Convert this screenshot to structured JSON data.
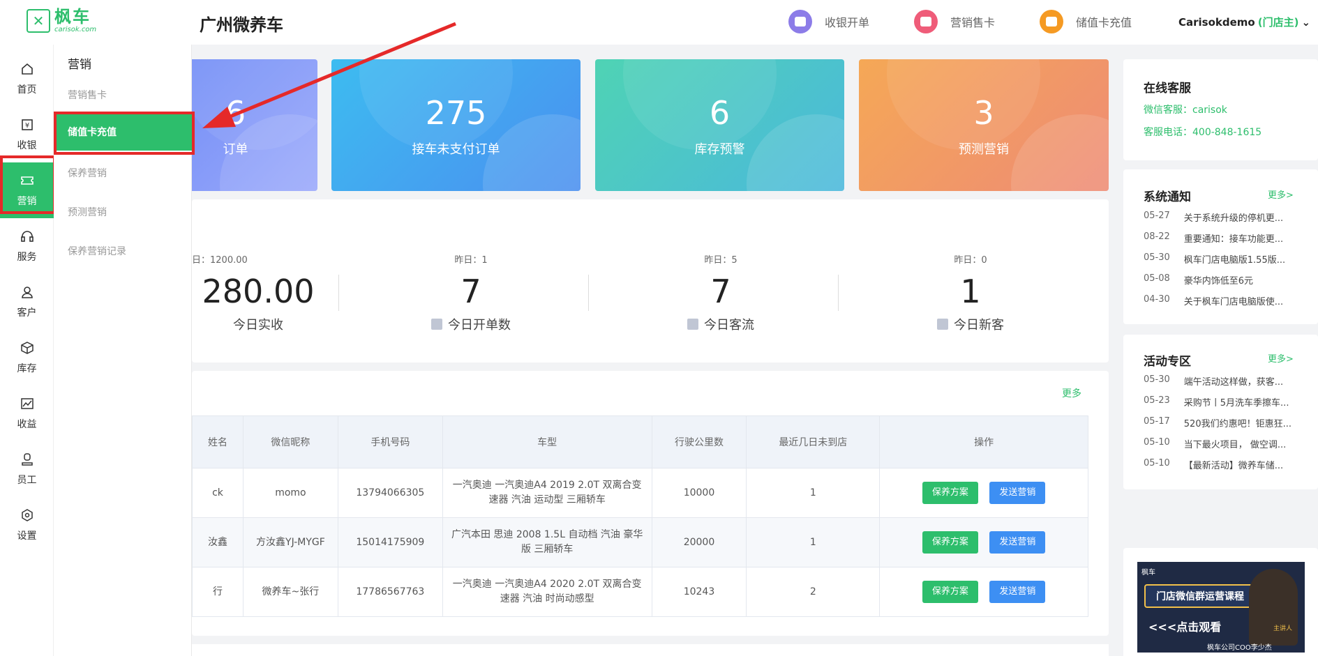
{
  "brand": {
    "name": "枫车",
    "sub": "carisok.com"
  },
  "header": {
    "store_name": "广州微养车",
    "actions": [
      {
        "label": "收银开单",
        "icon": "receipt-icon",
        "color": "#8c7ce8"
      },
      {
        "label": "营销售卡",
        "icon": "card-icon",
        "color": "#ef5c79"
      },
      {
        "label": "储值卡充值",
        "icon": "wallet-icon",
        "color": "#f59a23"
      }
    ],
    "user": "Carisokdemo",
    "role": "(门店主)"
  },
  "sidebar": {
    "items": [
      {
        "label": "首页",
        "icon": "home-icon"
      },
      {
        "label": "收银",
        "icon": "yen-icon"
      },
      {
        "label": "营销",
        "icon": "ticket-icon"
      },
      {
        "label": "服务",
        "icon": "headset-icon"
      },
      {
        "label": "客户",
        "icon": "person-icon"
      },
      {
        "label": "库存",
        "icon": "box-icon"
      },
      {
        "label": "收益",
        "icon": "chart-icon"
      },
      {
        "label": "员工",
        "icon": "staff-icon"
      },
      {
        "label": "设置",
        "icon": "settings-icon"
      }
    ],
    "active_index": 2
  },
  "submenu": {
    "title": "营销",
    "items": [
      "营销售卡",
      "储值卡充值",
      "保养营销",
      "预测营销",
      "保养营销记录"
    ],
    "active_index": 1
  },
  "stat_cards": [
    {
      "value": "6",
      "label": "订单",
      "color_from": "#6f8cf6",
      "color_to": "#9aa8fb"
    },
    {
      "value": "275",
      "label": "接车未支付订单",
      "color_from": "#3dbcf0",
      "color_to": "#4a8ff0"
    },
    {
      "value": "6",
      "label": "库存预警",
      "color_from": "#4fd3b4",
      "color_to": "#4bb8dc"
    },
    {
      "value": "3",
      "label": "预测营销",
      "color_from": "#f5a856",
      "color_to": "#ee8b75"
    }
  ],
  "metrics": [
    {
      "yesterday": "日：1200.00",
      "value": "280.00",
      "label": "今日实收"
    },
    {
      "yesterday": "昨日：1",
      "value": "7",
      "label": "今日开单数"
    },
    {
      "yesterday": "昨日：5",
      "value": "7",
      "label": "今日客流"
    },
    {
      "yesterday": "昨日：0",
      "value": "1",
      "label": "今日新客"
    }
  ],
  "customer_table": {
    "more": "更多",
    "headers": [
      "姓名",
      "微信昵称",
      "手机号码",
      "车型",
      "行驶公里数",
      "最近几日未到店",
      "操作"
    ],
    "rows": [
      {
        "name": "ck",
        "wechat": "momo",
        "phone": "13794066305",
        "model": "一汽奥迪 一汽奥迪A4 2019 2.0T 双离合变速器 汽油 运动型 三厢轿车",
        "km": "10000",
        "days": "1"
      },
      {
        "name": "汝鑫",
        "wechat": "方汝鑫YJ-MYGF",
        "phone": "15014175909",
        "model": "广汽本田 思迪 2008 1.5L 自动档 汽油 豪华版 三厢轿车",
        "km": "20000",
        "days": "1"
      },
      {
        "name": "行",
        "wechat": "微养车~张行",
        "phone": "17786567763",
        "model": "一汽奥迪 一汽奥迪A4 2020 2.0T 双离合变速器 汽油 时尚动感型",
        "km": "10243",
        "days": "2"
      }
    ],
    "btn_plan": "保养方案",
    "btn_send": "发送营销"
  },
  "service": {
    "title": "在线客服",
    "wechat": "微信客服：carisok",
    "phone": "客服电话：400-848-1615"
  },
  "notices": {
    "title": "系统通知",
    "more": "更多>",
    "items": [
      {
        "date": "05-27",
        "text": "关于系统升级的停机更..."
      },
      {
        "date": "08-22",
        "text": "重要通知：接车功能更..."
      },
      {
        "date": "05-30",
        "text": "枫车门店电脑版1.55版..."
      },
      {
        "date": "05-08",
        "text": "豪华内饰低至6元"
      },
      {
        "date": "04-30",
        "text": "关于枫车门店电脑版使..."
      }
    ]
  },
  "activities": {
    "title": "活动专区",
    "more": "更多>",
    "items": [
      {
        "date": "05-30",
        "text": "端午活动这样做，获客..."
      },
      {
        "date": "05-23",
        "text": "采购节丨5月洗车季擦车..."
      },
      {
        "date": "05-17",
        "text": "520我们约惠吧！钜惠狂..."
      },
      {
        "date": "05-10",
        "text": "当下最火项目， 做空调..."
      },
      {
        "date": "05-10",
        "text": "【最新活动】微养车储..."
      }
    ]
  },
  "promo": {
    "logo": "枫车",
    "headline": "门店微信群运营课程",
    "cta": "<<<点击观看",
    "host": "主讲人",
    "caption": "枫车公司COO李少杰"
  }
}
